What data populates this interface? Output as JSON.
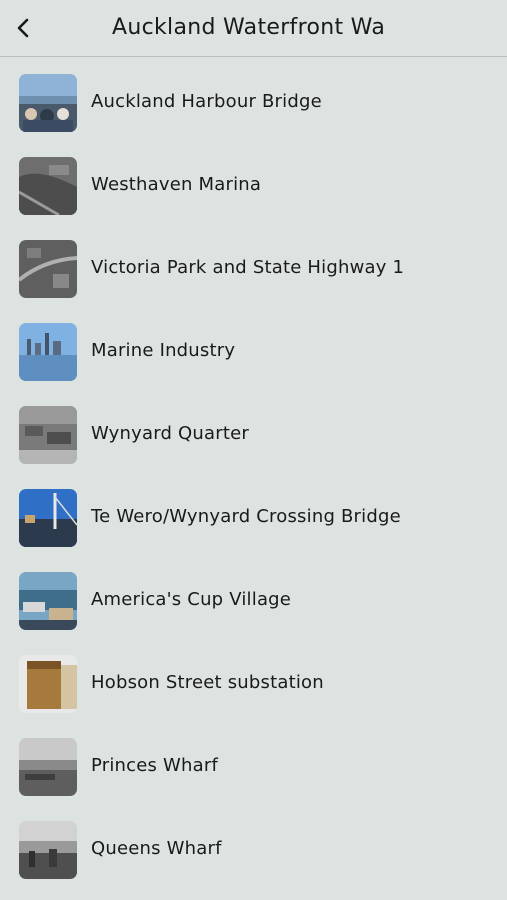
{
  "header": {
    "title": "Auckland Waterfront Wa",
    "back_icon": "chevron-left-icon"
  },
  "items": [
    {
      "label": "Auckland Harbour Bridge",
      "thumb": "photo-crowd-colour"
    },
    {
      "label": "Westhaven Marina",
      "thumb": "photo-aerial-bw"
    },
    {
      "label": "Victoria Park and State Highway 1",
      "thumb": "photo-aerial-bw"
    },
    {
      "label": "Marine Industry",
      "thumb": "photo-skyline-colour"
    },
    {
      "label": "Wynyard Quarter",
      "thumb": "photo-aerial-bw"
    },
    {
      "label": "Te Wero/Wynyard Crossing Bridge",
      "thumb": "photo-bridge-colour"
    },
    {
      "label": "America's Cup Village",
      "thumb": "photo-harbour-colour"
    },
    {
      "label": "Hobson Street substation",
      "thumb": "photo-building-colour"
    },
    {
      "label": "Princes Wharf",
      "thumb": "photo-wharf-bw"
    },
    {
      "label": "Queens Wharf",
      "thumb": "photo-wharf-bw"
    }
  ]
}
